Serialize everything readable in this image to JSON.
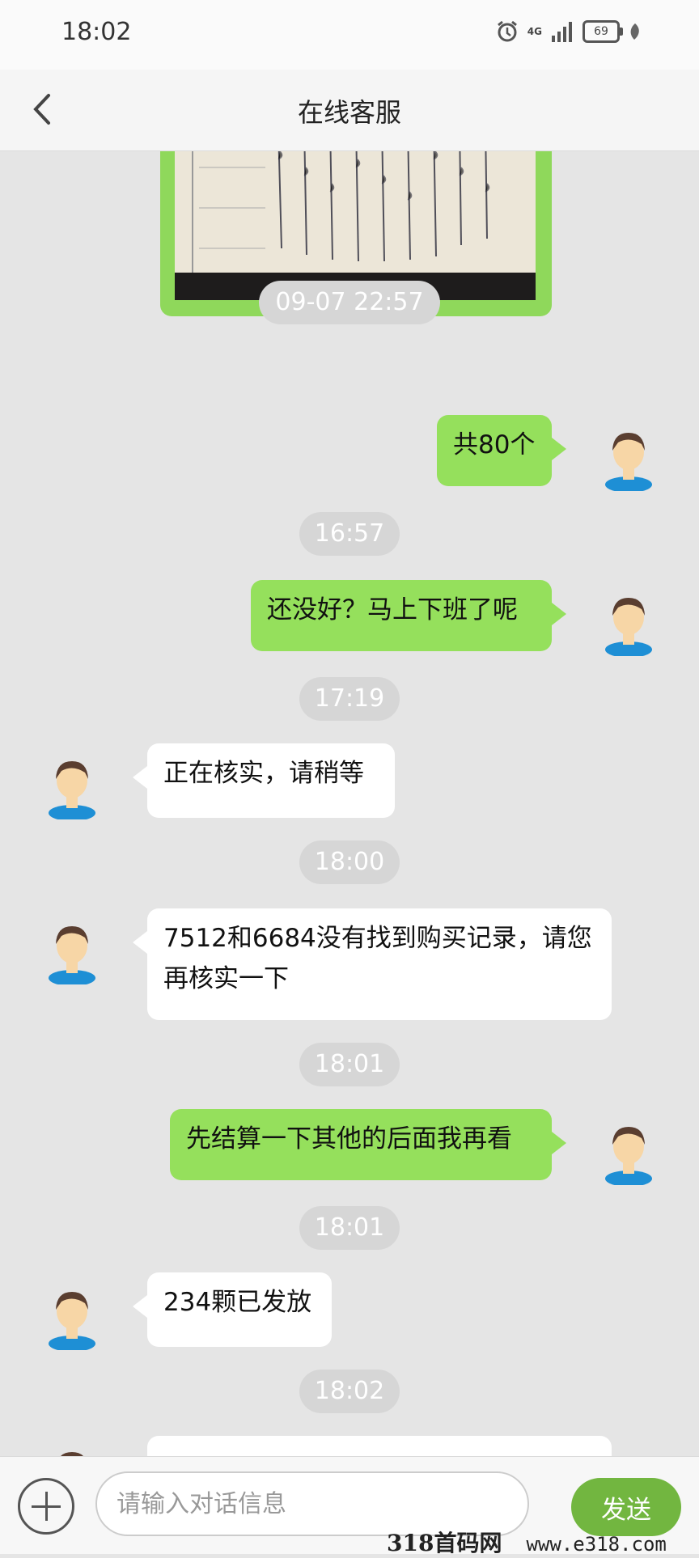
{
  "status_bar": {
    "time": "18:02",
    "network": "4G",
    "battery": "69"
  },
  "header": {
    "title": "在线客服"
  },
  "messages": [
    {
      "type": "time",
      "text": "09-07 22:57"
    },
    {
      "type": "me",
      "text": "共80个"
    },
    {
      "type": "time",
      "text": "16:57"
    },
    {
      "type": "me",
      "text": "还没好？马上下班了呢"
    },
    {
      "type": "time",
      "text": "17:19"
    },
    {
      "type": "agent",
      "text": "正在核实，请稍等"
    },
    {
      "type": "time",
      "text": "18:00"
    },
    {
      "type": "agent",
      "text": "7512和6684没有找到购买记录，请您再核实一下"
    },
    {
      "type": "time",
      "text": "18:01"
    },
    {
      "type": "me",
      "text": "先结算一下其他的后面我再看"
    },
    {
      "type": "time",
      "text": "18:01"
    },
    {
      "type": "agent",
      "text": "234颗已发放"
    },
    {
      "type": "time",
      "text": "18:02"
    }
  ],
  "input_bar": {
    "placeholder": "请输入对话信息",
    "send_label": "发送"
  },
  "watermark": {
    "text": "318首码网",
    "url": "www.e318.com"
  },
  "colors": {
    "me_bubble": "#95e05c",
    "agent_bubble": "#ffffff",
    "send_button": "#72b640"
  }
}
